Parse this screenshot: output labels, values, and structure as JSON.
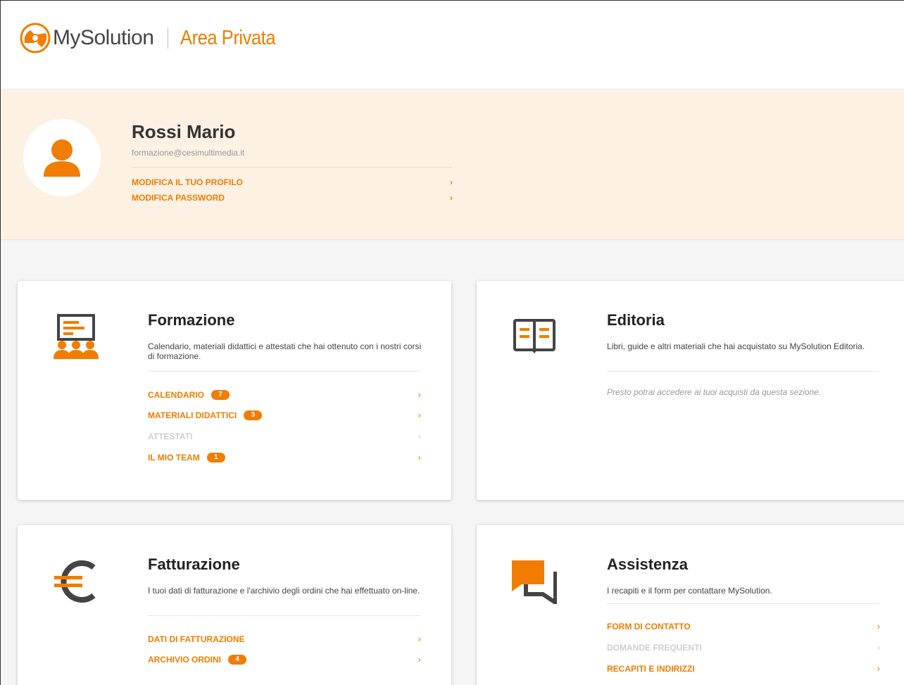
{
  "header": {
    "brand": "MySolution",
    "area": "Area Privata"
  },
  "profile": {
    "name": "Rossi Mario",
    "email": "formazione@cesimultimedia.it",
    "links": [
      {
        "label": "MODIFICA IL TUO PROFILO"
      },
      {
        "label": "MODIFICA PASSWORD"
      }
    ]
  },
  "cards": {
    "formazione": {
      "title": "Formazione",
      "description": "Calendario, materiali didattici e attestati che hai ottenuto con i nostri corsi di formazione.",
      "icon": "presentation-icon",
      "items": [
        {
          "label": "CALENDARIO",
          "badge": "7",
          "enabled": true
        },
        {
          "label": "MATERIALI DIDATTICI",
          "badge": "3",
          "enabled": true
        },
        {
          "label": "ATTESTATI",
          "badge": null,
          "enabled": false
        },
        {
          "label": "IL MIO TEAM",
          "badge": "1",
          "enabled": true
        }
      ]
    },
    "editoria": {
      "title": "Editoria",
      "description": "Libri, guide e altri materiali che hai acquistato su MySolution Editoria.",
      "icon": "book-icon",
      "note": "Presto potrai accedere ai tuoi acquisti da questa sezione."
    },
    "fatturazione": {
      "title": "Fatturazione",
      "description": "I tuoi dati di fatturazione e l'archivio degli ordini che hai effettuato on-line.",
      "icon": "euro-icon",
      "items": [
        {
          "label": "DATI DI FATTURAZIONE",
          "badge": null,
          "enabled": true
        },
        {
          "label": "ARCHIVIO ORDINI",
          "badge": "4",
          "enabled": true
        }
      ]
    },
    "assistenza": {
      "title": "Assistenza",
      "description": "I recapiti e il form per contattare MySolution.",
      "icon": "chat-icon",
      "items": [
        {
          "label": "FORM DI CONTATTO",
          "badge": null,
          "enabled": true
        },
        {
          "label": "DOMANDE FREQUENTI",
          "badge": null,
          "enabled": false
        },
        {
          "label": "RECAPITI E INDIRIZZI",
          "badge": null,
          "enabled": true
        }
      ]
    }
  },
  "colors": {
    "accent": "#f07d00",
    "profile_bg": "#fdf1e4",
    "disabled": "#cfcfcf",
    "icon_dark": "#444444"
  }
}
